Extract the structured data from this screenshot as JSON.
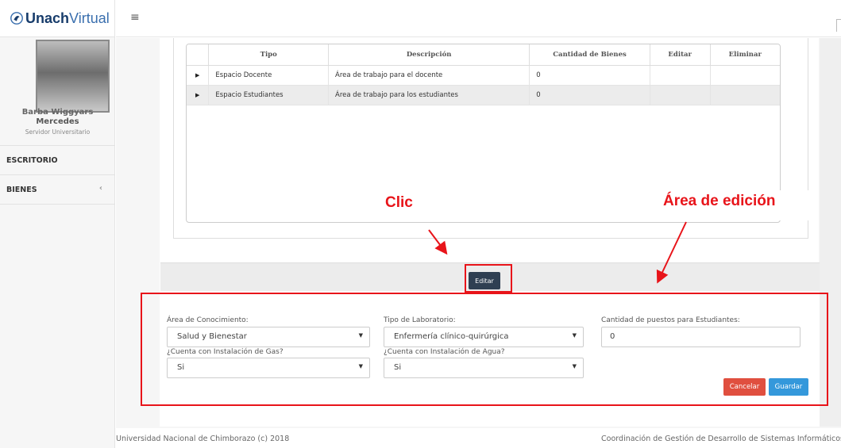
{
  "app": {
    "brand_bold": "Unach",
    "brand_light": "Virtual"
  },
  "user": {
    "name_line1": "Barba Wiggyars",
    "name_line2": "Mercedes",
    "role": "Servidor Universitario"
  },
  "menu": {
    "items": [
      {
        "label": "ESCRITORIO"
      },
      {
        "label": "BIENES",
        "chevron": "‹"
      }
    ]
  },
  "topbar": {
    "menu_icon": "≡"
  },
  "grid": {
    "columns": [
      "",
      "Tipo",
      "Descripción",
      "Cantidad de Bienes",
      "Editar",
      "Eliminar"
    ],
    "rows": [
      {
        "tipo": "Espacio Docente",
        "descripcion": "Área de trabajo para el docente",
        "cantidad": "0"
      },
      {
        "tipo": "Espacio Estudiantes",
        "descripcion": "Área de trabajo para los estudiantes",
        "cantidad": "0"
      }
    ]
  },
  "edit_button": "Editar",
  "form": {
    "area_label": "Área de Conocimiento:",
    "area_value": "Salud y Bienestar",
    "tipo_label": "Tipo de Laboratorio:",
    "tipo_value": "Enfermería clínico-quirúrgica",
    "cantidad_label": "Cantidad de puestos para Estudiantes:",
    "cantidad_value": "0",
    "gas_label": "¿Cuenta con Instalación de Gas?",
    "gas_value": "Si",
    "agua_label": "¿Cuenta con Instalación de Agua?",
    "agua_value": "Si",
    "cancel_label": "Cancelar",
    "save_label": "Guardar"
  },
  "annotations": {
    "clic": "Clic",
    "area_edicion": "Área de edición",
    "color": "#e8141a"
  },
  "footer": {
    "left": "Universidad Nacional de Chimborazo (c) 2018",
    "right": "Coordinación de Gestión de Desarrollo de Sistemas Informáticos"
  }
}
